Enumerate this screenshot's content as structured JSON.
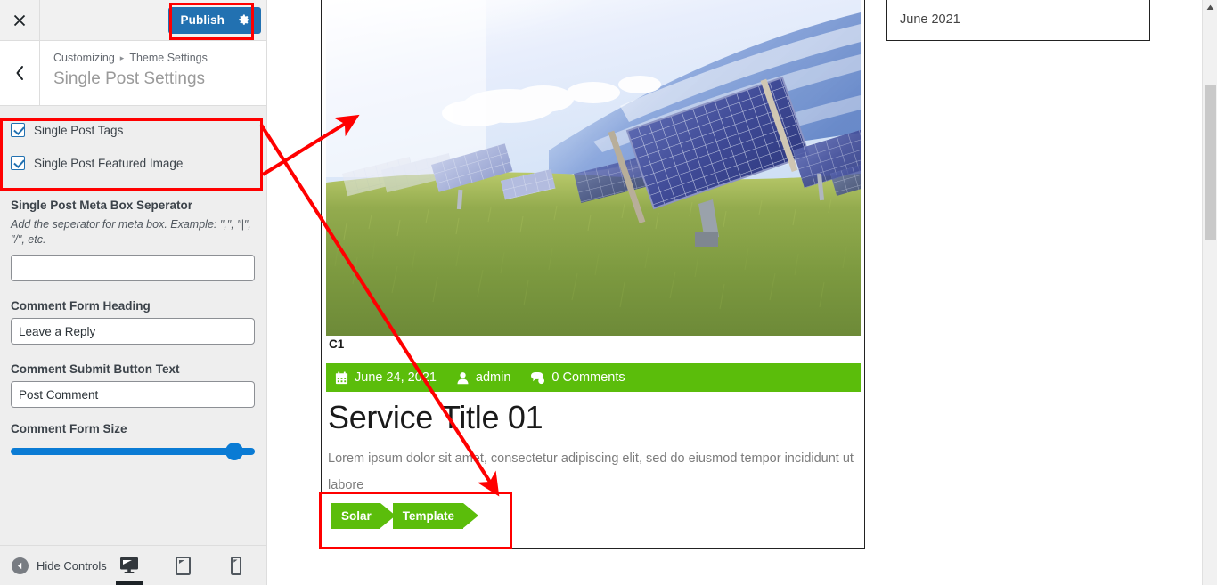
{
  "customizer": {
    "header": {
      "close_icon": "close-icon",
      "publish_label": "Publish",
      "gear_icon": "gear-icon"
    },
    "back_icon": "chevron-left-icon",
    "breadcrumb": {
      "root": "Customizing",
      "separator": "▸",
      "parent": "Theme Settings"
    },
    "section_title": "Single Post Settings",
    "checkboxes": [
      {
        "label": "Single Post Tags",
        "checked": true
      },
      {
        "label": "Single Post Featured Image",
        "checked": true
      }
    ],
    "fields": [
      {
        "label": "Single Post Meta Box Seperator",
        "description": "Add the seperator for meta box. Example: \",\", \"|\", \"/\", etc.",
        "value": "",
        "placeholder": ""
      },
      {
        "label": "Comment Form Heading",
        "value": "Leave a Reply"
      },
      {
        "label": "Comment Submit Button Text",
        "value": "Post Comment"
      }
    ],
    "slider": {
      "label": "Comment Form Size",
      "percent": 95,
      "color": "#0a7bd4"
    },
    "footer": {
      "hide_controls_label": "Hide Controls",
      "devices": [
        {
          "name": "desktop",
          "active": true
        },
        {
          "name": "tablet",
          "active": false
        },
        {
          "name": "mobile",
          "active": false
        }
      ]
    }
  },
  "preview": {
    "c1_label": "C1",
    "featured_image_alt": "solar-panels-in-grass-field",
    "meta": {
      "date": "June 24, 2021",
      "author": "admin",
      "comments": "0 Comments",
      "bar_color": "#5bbd0b"
    },
    "title": "Service Title 01",
    "excerpt": "Lorem ipsum dolor sit amet, consectetur adipiscing elit, sed do eiusmod tempor incididunt ut labore",
    "tags": [
      "Solar",
      "Template"
    ],
    "archive_widget": {
      "label": "June 2021"
    }
  },
  "annotations": {
    "color": "#ff0000",
    "boxes": [
      "publish-button",
      "checkbox-group",
      "post-tags"
    ],
    "arrows": [
      "checkboxes-to-featured-image",
      "checkboxes-to-tags"
    ]
  }
}
